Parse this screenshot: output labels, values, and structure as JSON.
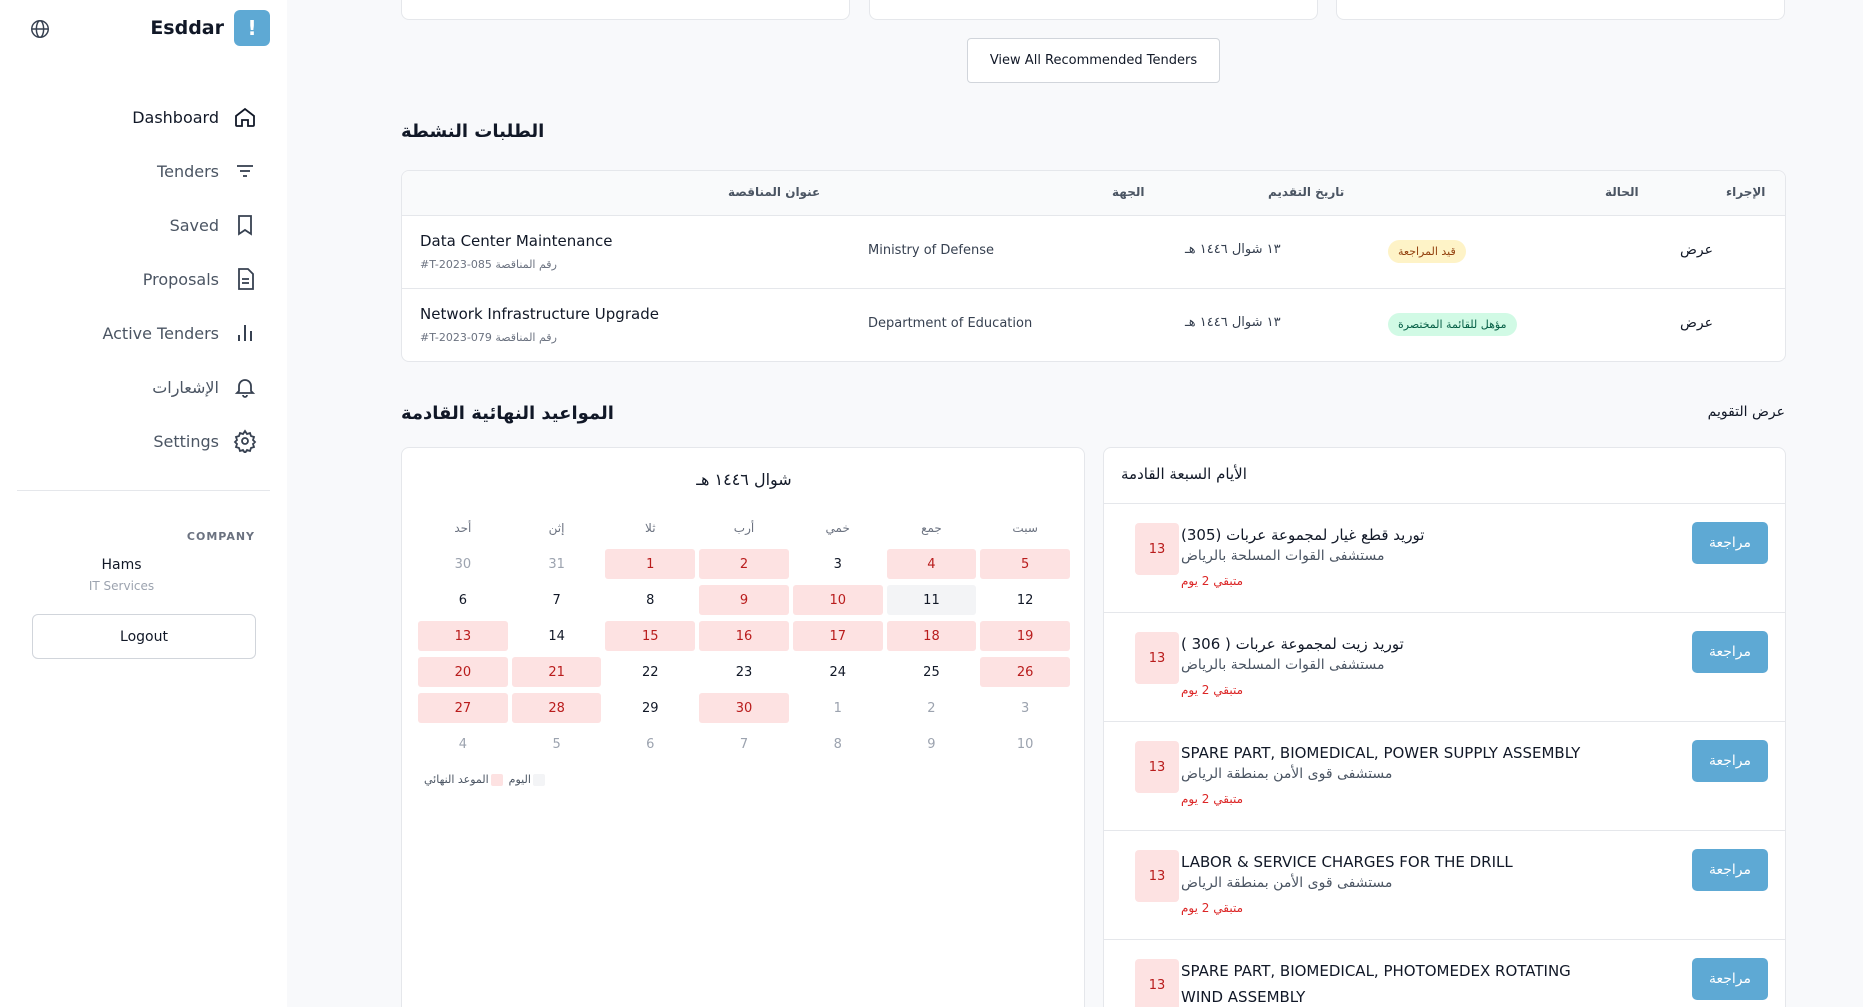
{
  "sidebar": {
    "brand": "Esddar",
    "brand_logo": "!",
    "nav": [
      {
        "label": "Dashboard",
        "icon": "home-icon",
        "active": true
      },
      {
        "label": "Tenders",
        "icon": "filter-icon"
      },
      {
        "label": "Saved",
        "icon": "bookmark-icon"
      },
      {
        "label": "Proposals",
        "icon": "document-icon"
      },
      {
        "label": "Active Tenders",
        "icon": "bar-chart-icon"
      },
      {
        "label": "الإشعارات",
        "icon": "bell-icon"
      },
      {
        "label": "Settings",
        "icon": "gear-icon"
      }
    ],
    "company_label": "COMPANY",
    "company_name": "Hams",
    "company_sub": "IT Services",
    "logout": "Logout"
  },
  "recommended": {
    "view_all": "View All Recommended Tenders"
  },
  "active": {
    "title": "الطلبات النشطة",
    "headers": {
      "title": "عنوان المناقصة",
      "entity": "الجهة",
      "date": "تاريخ التقديم",
      "status": "الحالة",
      "action": "الإجراء"
    },
    "rows": [
      {
        "title": "Data Center Maintenance",
        "number": "#T-2023-085 رقم المناقصة",
        "entity": "Ministry of Defense",
        "date": "١٣ شوال ١٤٤٦ هـ",
        "status": "قيد المراجعة",
        "status_type": "review",
        "action": "عرض"
      },
      {
        "title": "Network Infrastructure Upgrade",
        "number": "#T-2023-079 رقم المناقصة",
        "entity": "Department of Education",
        "date": "١٣ شوال ١٤٤٦ هـ",
        "status": "مؤهل للقائمة المختصرة",
        "status_type": "short",
        "action": "عرض"
      }
    ]
  },
  "deadlines": {
    "title": "المواعيد النهائية القادمة",
    "calendar_link": "عرض التقويم"
  },
  "calendar": {
    "title": "شوال ١٤٤٦ هـ",
    "weekdays": [
      "سبت",
      "جمع",
      "خمي",
      "أرب",
      "ثلا",
      "إثن",
      "أحد"
    ],
    "weeks": [
      [
        {
          "d": "5",
          "t": "deadline"
        },
        {
          "d": "4",
          "t": "deadline"
        },
        {
          "d": "3",
          "t": ""
        },
        {
          "d": "2",
          "t": "deadline"
        },
        {
          "d": "1",
          "t": "deadline"
        },
        {
          "d": "31",
          "t": "muted"
        },
        {
          "d": "30",
          "t": "muted"
        }
      ],
      [
        {
          "d": "12",
          "t": ""
        },
        {
          "d": "11",
          "t": "today"
        },
        {
          "d": "10",
          "t": "deadline"
        },
        {
          "d": "9",
          "t": "deadline"
        },
        {
          "d": "8",
          "t": ""
        },
        {
          "d": "7",
          "t": ""
        },
        {
          "d": "6",
          "t": ""
        }
      ],
      [
        {
          "d": "19",
          "t": "deadline"
        },
        {
          "d": "18",
          "t": "deadline"
        },
        {
          "d": "17",
          "t": "deadline"
        },
        {
          "d": "16",
          "t": "deadline"
        },
        {
          "d": "15",
          "t": "deadline"
        },
        {
          "d": "14",
          "t": ""
        },
        {
          "d": "13",
          "t": "deadline"
        }
      ],
      [
        {
          "d": "26",
          "t": "deadline"
        },
        {
          "d": "25",
          "t": ""
        },
        {
          "d": "24",
          "t": ""
        },
        {
          "d": "23",
          "t": ""
        },
        {
          "d": "22",
          "t": ""
        },
        {
          "d": "21",
          "t": "deadline"
        },
        {
          "d": "20",
          "t": "deadline"
        }
      ],
      [
        {
          "d": "3",
          "t": "muted"
        },
        {
          "d": "2",
          "t": "muted"
        },
        {
          "d": "1",
          "t": "muted"
        },
        {
          "d": "30",
          "t": "deadline"
        },
        {
          "d": "29",
          "t": ""
        },
        {
          "d": "28",
          "t": "deadline"
        },
        {
          "d": "27",
          "t": "deadline"
        }
      ],
      [
        {
          "d": "10",
          "t": "muted"
        },
        {
          "d": "9",
          "t": "muted"
        },
        {
          "d": "8",
          "t": "muted"
        },
        {
          "d": "7",
          "t": "muted"
        },
        {
          "d": "6",
          "t": "muted"
        },
        {
          "d": "5",
          "t": "muted"
        },
        {
          "d": "4",
          "t": "muted"
        }
      ]
    ],
    "legend_today": "اليوم",
    "legend_deadline": "الموعد النهائي"
  },
  "upcoming": {
    "title": "الأيام السبعة القادمة",
    "items": [
      {
        "date": "13",
        "name": "توريد قطع غيار لمجموعة عربات (305)",
        "org": "مستشفى القوات المسلحة بالرياض",
        "left": "متبقي 2 يوم",
        "button": "مراجعة"
      },
      {
        "date": "13",
        "name": "توريد زيت لمجموعة عربات ( 306 )",
        "org": "مستشفى القوات المسلحة بالرياض",
        "left": "متبقي 2 يوم",
        "button": "مراجعة"
      },
      {
        "date": "13",
        "name": "SPARE PART, BIOMEDICAL, POWER SUPPLY ASSEMBLY",
        "org": "مستشفى قوى الأمن بمنطقة الرياض",
        "left": "متبقي 2 يوم",
        "button": "مراجعة"
      },
      {
        "date": "13",
        "name": "LABOR & SERVICE CHARGES FOR THE DRILL",
        "org": "مستشفى قوى الأمن بمنطقة الرياض",
        "left": "متبقي 2 يوم",
        "button": "مراجعة"
      },
      {
        "date": "13",
        "name": "SPARE PART, BIOMEDICAL, PHOTOMEDEX ROTATING WIND ASSEMBLY",
        "org": "",
        "left": "",
        "button": "مراجعة"
      }
    ]
  },
  "colors": {
    "accent": "#5ea9d4",
    "deadline_bg": "#fde2e2",
    "deadline_text": "#b91c1c"
  }
}
